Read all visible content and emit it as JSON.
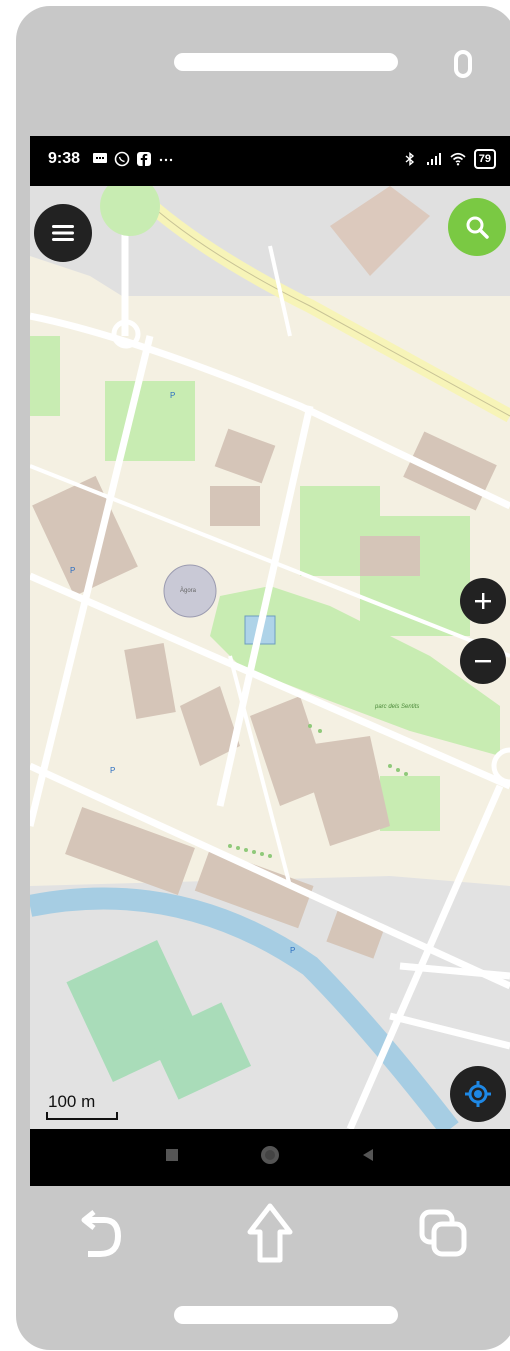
{
  "status_bar": {
    "time": "9:38",
    "left_icons": [
      "message-icon",
      "whatsapp-icon",
      "facebook-icon",
      "more-dots-icon"
    ],
    "right_icons": [
      "bluetooth-icon",
      "signal-icon",
      "wifi-icon"
    ],
    "battery": "79"
  },
  "map": {
    "scale_label": "100 m",
    "labels": {
      "agora": "Àgora",
      "parc": "parc dels Sentits",
      "p1": "P",
      "p2": "P",
      "p3": "P",
      "p4": "P"
    }
  },
  "colors": {
    "search_fab": "#7ac943",
    "dark_fab": "#222222",
    "locate_accent": "#1e88e5",
    "map_base": "#f4f0e2",
    "park": "#c8ecb2",
    "water": "#a6cde3",
    "road_trunk": "#f7f4b8"
  },
  "controls": {
    "menu_icon": "hamburger-menu-icon",
    "search_icon": "search-icon",
    "zoom_in_icon": "plus-icon",
    "zoom_out_icon": "minus-icon",
    "locate_icon": "my-location-icon"
  },
  "navigation": {
    "android": [
      "recents-square-icon",
      "home-circle-icon",
      "back-triangle-icon"
    ],
    "device": [
      "back-arrow-icon",
      "home-outline-icon",
      "overview-icon"
    ]
  }
}
